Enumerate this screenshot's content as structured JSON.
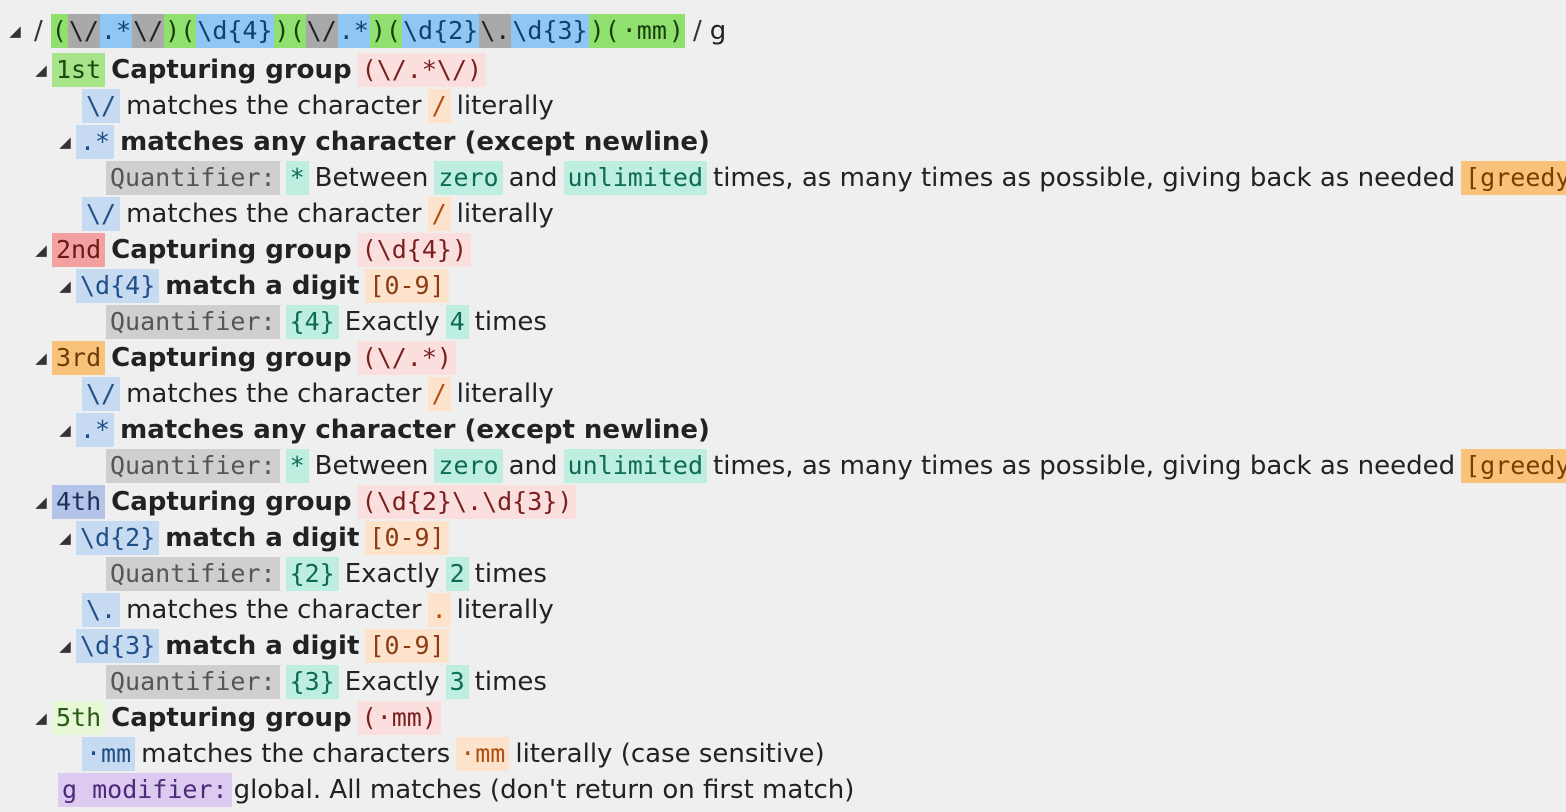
{
  "regex": {
    "toggle": "◢",
    "open_delim": "/",
    "close_delim": "/",
    "flags": "g",
    "tokens": [
      {
        "t": "(",
        "c": "rg"
      },
      {
        "t": "\\/",
        "c": "rgray"
      },
      {
        "t": ".*",
        "c": "rblue"
      },
      {
        "t": "\\/",
        "c": "rgray"
      },
      {
        "t": ")(",
        "c": "rg"
      },
      {
        "t": "\\d{4}",
        "c": "rblue"
      },
      {
        "t": ")(",
        "c": "rg"
      },
      {
        "t": "\\/",
        "c": "rgray"
      },
      {
        "t": ".*",
        "c": "rblue"
      },
      {
        "t": ")(",
        "c": "rg"
      },
      {
        "t": "\\d{2}",
        "c": "rblue"
      },
      {
        "t": "\\.",
        "c": "rgray"
      },
      {
        "t": "\\d{3}",
        "c": "rblue"
      },
      {
        "t": ")(",
        "c": "rg"
      },
      {
        "t": "·mm",
        "c": "rg"
      },
      {
        "t": ")",
        "c": "rg"
      }
    ]
  },
  "common": {
    "matches_char": "matches the character",
    "matches_chars": "matches the characters",
    "literally": "literally",
    "literally_case": "literally (case sensitive)",
    "any_char": "matches any character (except newline)",
    "match_digit": "match a digit",
    "digit_class": "[0-9]",
    "quantifier": "Quantifier:",
    "between": "Between",
    "zero": "zero",
    "and": "and",
    "unlimited": "unlimited",
    "greedy_text": "times, as many times as possible, giving back as needed",
    "greedy": "[greedy]",
    "exactly": "Exactly",
    "times": "times",
    "capturing_group": "Capturing group",
    "slash_tok": "\\/",
    "slash_lit": "/",
    "dotstar": ".*",
    "star": "*",
    "escdot": "\\.",
    "dot_lit": ".",
    "mm_tok": "·mm",
    "mm_lit": "·mm"
  },
  "groups": [
    {
      "ord": "1st",
      "pattern": "(\\/.*\\/)"
    },
    {
      "ord": "2nd",
      "pattern": "(\\d{4})",
      "digit_tok": "\\d{4}",
      "q": "{4}",
      "n": "4"
    },
    {
      "ord": "3rd",
      "pattern": "(\\/.*)"
    },
    {
      "ord": "4th",
      "pattern": "(\\d{2}\\.\\d{3})",
      "d2_tok": "\\d{2}",
      "q2": "{2}",
      "n2": "2",
      "d3_tok": "\\d{3}",
      "q3": "{3}",
      "n3": "3"
    },
    {
      "ord": "5th",
      "pattern": "(·mm)"
    }
  ],
  "modifier": {
    "label": "g modifier:",
    "desc": "global. All matches (don't return on first match)"
  }
}
